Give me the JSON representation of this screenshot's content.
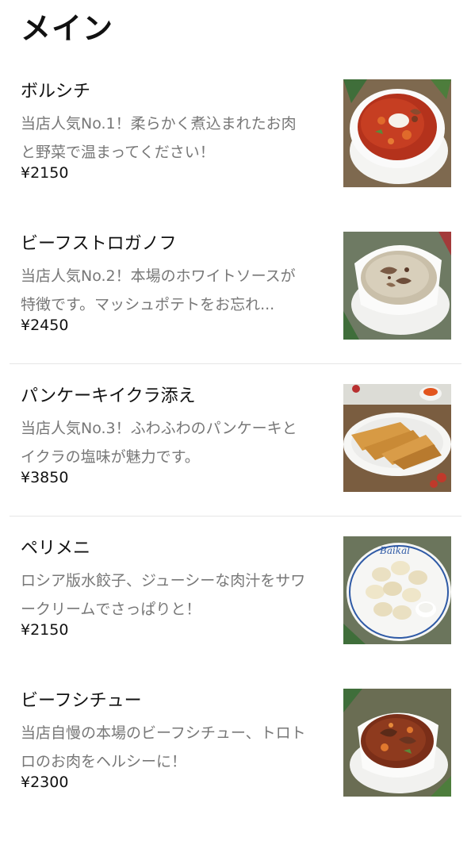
{
  "section": {
    "title": "メイン"
  },
  "items": [
    {
      "name": "ボルシチ",
      "description": "当店人気No.1！柔らかく煮込まれたお肉と野菜で温まってください！",
      "price": "¥2150",
      "photo_icon": "borscht-photo"
    },
    {
      "name": "ビーフストロガノフ",
      "description": "当店人気No.2！本場のホワイトソースが特徴です。マッシュポテトをお忘れ...",
      "price": "¥2450",
      "photo_icon": "beef-stroganoff-photo"
    },
    {
      "name": "パンケーキイクラ添え",
      "description": "当店人気No.3！ふわふわのパンケーキとイクラの塩味が魅力です。",
      "price": "¥3850",
      "photo_icon": "pancake-ikura-photo"
    },
    {
      "name": "ペリメニ",
      "description": "ロシア版水餃子、ジューシーな肉汁をサワークリームでさっぱりと！",
      "price": "¥2150",
      "photo_icon": "pelmeni-photo"
    },
    {
      "name": "ビーフシチュー",
      "description": "当店自慢の本場のビーフシチュー、トロトロのお肉をヘルシーに！",
      "price": "¥2300",
      "photo_icon": "beef-stew-photo"
    }
  ],
  "plate_text": "Baikal",
  "colors": {
    "text": "#111111",
    "description": "#777777",
    "divider": "#e6e6e6"
  }
}
